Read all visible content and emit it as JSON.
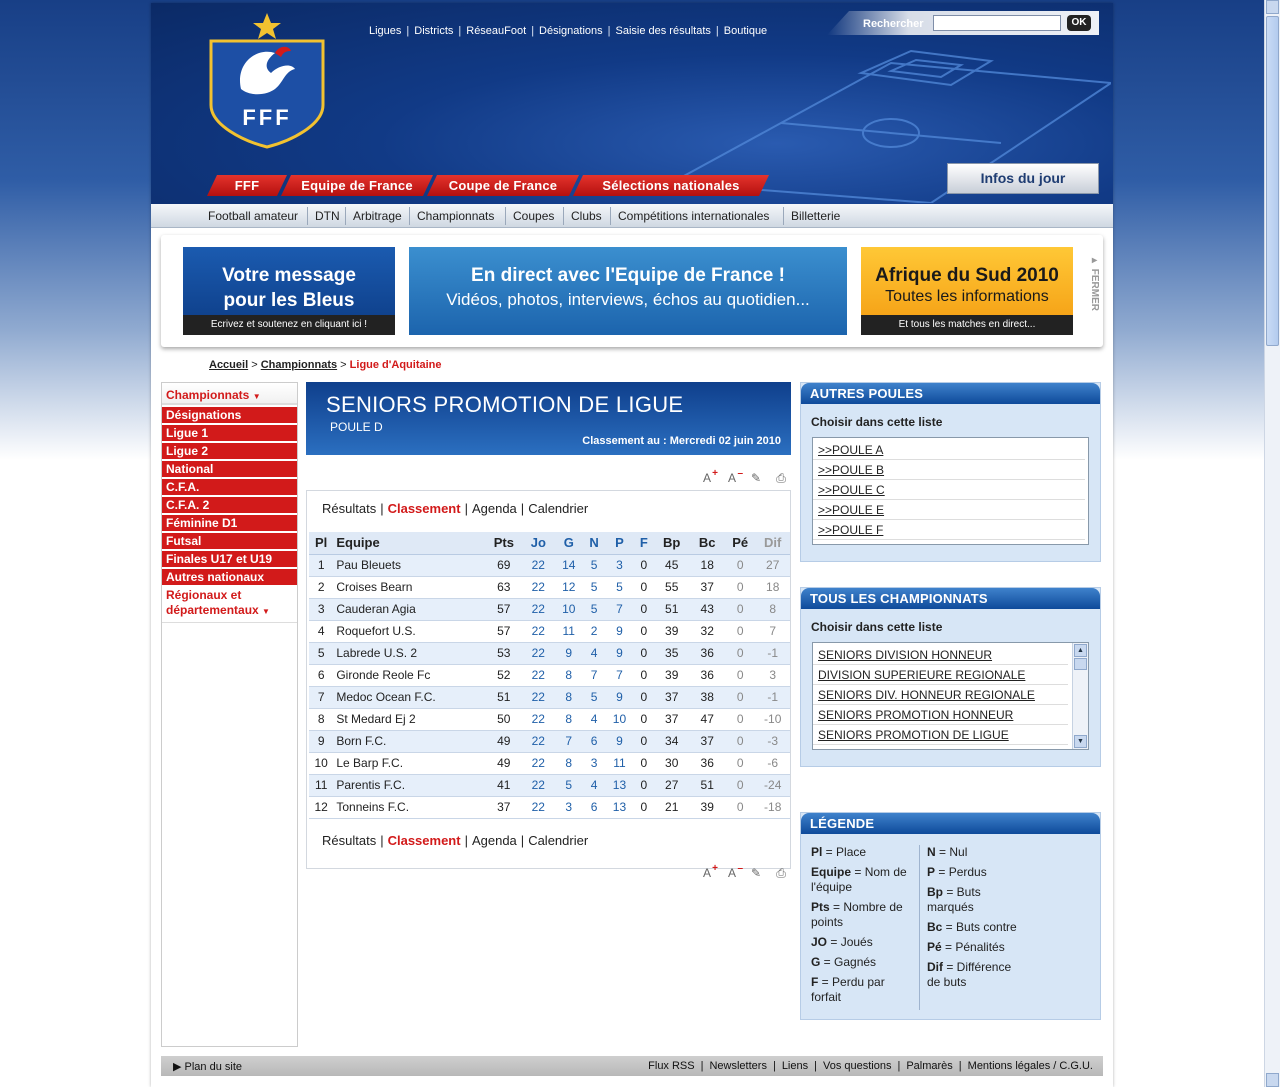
{
  "header": {
    "logo_text": "FFF",
    "top_links": [
      "Ligues",
      "Districts",
      "RéseauFoot",
      "Désignations",
      "Saisie des résultats",
      "Boutique"
    ],
    "search_label": "Rechercher",
    "search_value": "",
    "search_button": "OK",
    "red_tabs": [
      "FFF",
      "Equipe de France",
      "Coupe de France",
      "Sélections nationales"
    ],
    "infos_button": "Infos du jour"
  },
  "subnav": [
    "Football amateur",
    "DTN",
    "Arbitrage",
    "Championnats",
    "Coupes",
    "Clubs",
    "Compétitions internationales",
    "Billetterie"
  ],
  "banners": {
    "b1_line1": "Votre message",
    "b1_line2": "pour les Bleus",
    "b1_foot": "Ecrivez et soutenez en cliquant ici !",
    "b2_line1": "En direct avec l'Equipe de France !",
    "b2_line2": "Vidéos, photos, interviews, échos au quotidien...",
    "b3_line1": "Afrique du Sud 2010",
    "b3_line2": "Toutes les informations",
    "b3_foot": "Et tous les matches en direct...",
    "close": "FERMER"
  },
  "breadcrumb": {
    "home": "Accueil",
    "sep": ">",
    "section": "Championnats",
    "current": "Ligue d'Aquitaine"
  },
  "leftnav": {
    "head": "Championnats",
    "items": [
      "Désignations",
      "Ligue 1",
      "Ligue 2",
      "National",
      "C.F.A.",
      "C.F.A. 2",
      "Féminine D1",
      "Futsal",
      "Finales U17 et U19",
      "Autres nationaux"
    ],
    "regional": "Régionaux et départementaux"
  },
  "competition": {
    "title": "SENIORS PROMOTION DE LIGUE",
    "poule": "POULE D",
    "date": "Classement au : Mercredi 02 juin 2010"
  },
  "tabs": {
    "resultats": "Résultats",
    "classement": "Classement",
    "agenda": "Agenda",
    "calendrier": "Calendrier",
    "sep": "|"
  },
  "table": {
    "headers": [
      "Pl",
      "Equipe",
      "Pts",
      "Jo",
      "G",
      "N",
      "P",
      "F",
      "Bp",
      "Bc",
      "Pé",
      "Dif"
    ],
    "rows": [
      [
        "1",
        "Pau Bleuets",
        "69",
        "22",
        "14",
        "5",
        "3",
        "0",
        "45",
        "18",
        "0",
        "27"
      ],
      [
        "2",
        "Croises Bearn",
        "63",
        "22",
        "12",
        "5",
        "5",
        "0",
        "55",
        "37",
        "0",
        "18"
      ],
      [
        "3",
        "Cauderan Agia",
        "57",
        "22",
        "10",
        "5",
        "7",
        "0",
        "51",
        "43",
        "0",
        "8"
      ],
      [
        "4",
        "Roquefort U.S.",
        "57",
        "22",
        "11",
        "2",
        "9",
        "0",
        "39",
        "32",
        "0",
        "7"
      ],
      [
        "5",
        "Labrede U.S. 2",
        "53",
        "22",
        "9",
        "4",
        "9",
        "0",
        "35",
        "36",
        "0",
        "-1"
      ],
      [
        "6",
        "Gironde Reole Fc",
        "52",
        "22",
        "8",
        "7",
        "7",
        "0",
        "39",
        "36",
        "0",
        "3"
      ],
      [
        "7",
        "Medoc Ocean F.C.",
        "51",
        "22",
        "8",
        "5",
        "9",
        "0",
        "37",
        "38",
        "0",
        "-1"
      ],
      [
        "8",
        "St Medard Ej 2",
        "50",
        "22",
        "8",
        "4",
        "10",
        "0",
        "37",
        "47",
        "0",
        "-10"
      ],
      [
        "9",
        "Born F.C.",
        "49",
        "22",
        "7",
        "6",
        "9",
        "0",
        "34",
        "37",
        "0",
        "-3"
      ],
      [
        "10",
        "Le Barp F.C.",
        "49",
        "22",
        "8",
        "3",
        "11",
        "0",
        "30",
        "36",
        "0",
        "-6"
      ],
      [
        "11",
        "Parentis F.C.",
        "41",
        "22",
        "5",
        "4",
        "13",
        "0",
        "27",
        "51",
        "0",
        "-24"
      ],
      [
        "12",
        "Tonneins F.C.",
        "37",
        "22",
        "3",
        "6",
        "13",
        "0",
        "21",
        "39",
        "0",
        "-18"
      ]
    ]
  },
  "autres_poules": {
    "title": "AUTRES POULES",
    "label": "Choisir dans cette liste",
    "items": [
      ">>POULE A",
      ">>POULE B",
      ">>POULE C",
      ">>POULE E",
      ">>POULE F"
    ]
  },
  "championnats": {
    "title": "TOUS LES CHAMPIONNATS",
    "label": "Choisir dans cette liste",
    "items": [
      "SENIORS DIVISION HONNEUR",
      "DIVISION SUPERIEURE REGIONALE",
      "SENIORS DIV. HONNEUR REGIONALE",
      "SENIORS PROMOTION HONNEUR",
      "SENIORS PROMOTION DE LIGUE"
    ]
  },
  "legende": {
    "title": "LÉGENDE",
    "left": [
      {
        "k": "Pl",
        "v": " = Place"
      },
      {
        "k": "Equipe",
        "v": " = Nom de l'équipe"
      },
      {
        "k": "Pts",
        "v": " = Nombre de points"
      },
      {
        "k": "JO",
        "v": " = Joués"
      },
      {
        "k": "G",
        "v": " = Gagnés"
      },
      {
        "k": "F",
        "v": " = Perdu par forfait"
      }
    ],
    "right": [
      {
        "k": "N",
        "v": " = Nul"
      },
      {
        "k": "P",
        "v": " = Perdus"
      },
      {
        "k": "Bp",
        "v": " = Buts marqués"
      },
      {
        "k": "Bc",
        "v": " = Buts contre"
      },
      {
        "k": "Pé",
        "v": " = Pénalités"
      },
      {
        "k": "Dif",
        "v": " = Différence de buts"
      }
    ]
  },
  "footer": {
    "left": "Plan du site",
    "right": [
      "Flux RSS",
      "Newsletters",
      "Liens",
      "Vos questions",
      "Palmarès",
      "Mentions légales / C.G.U."
    ]
  },
  "colors": {
    "brand_blue": "#0e4a9a",
    "red": "#d21a1a",
    "link_blue": "#1f5fa8"
  }
}
